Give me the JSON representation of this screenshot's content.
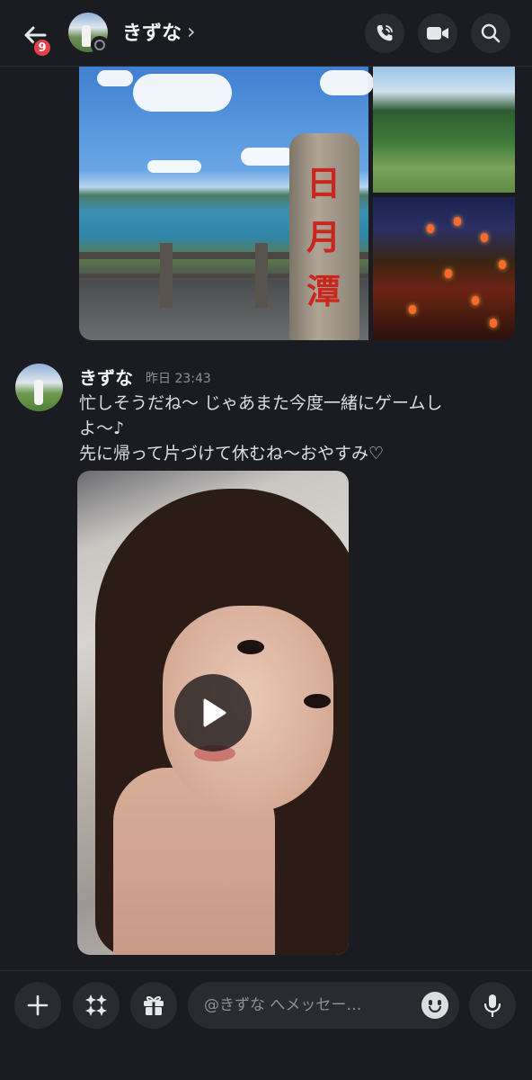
{
  "header": {
    "unread_count": "9",
    "title": "きずな",
    "chevron": "›"
  },
  "message": {
    "author": "きずな",
    "timestamp": "昨日 23:43",
    "lines": [
      "忙しそうだね〜 じゃあまた今度一緒にゲームし",
      "よ〜♪",
      "先に帰って片づけて休むね〜おやすみ♡"
    ]
  },
  "gallery": {
    "stone_text": "日月潭"
  },
  "composer": {
    "placeholder": "@きずな へメッセー…"
  },
  "icons": {
    "back": "arrow-left-icon",
    "call": "phone-call-icon",
    "video": "video-camera-icon",
    "search": "search-icon",
    "add": "plus-icon",
    "apps": "sparkle-apps-icon",
    "gift": "gift-icon",
    "emoji": "emoji-icon",
    "mic": "microphone-icon",
    "play": "play-icon"
  },
  "colors": {
    "background": "#1b1c21",
    "surface": "#2a2b31",
    "badge": "#e5404a",
    "text": "#dcdde1"
  }
}
